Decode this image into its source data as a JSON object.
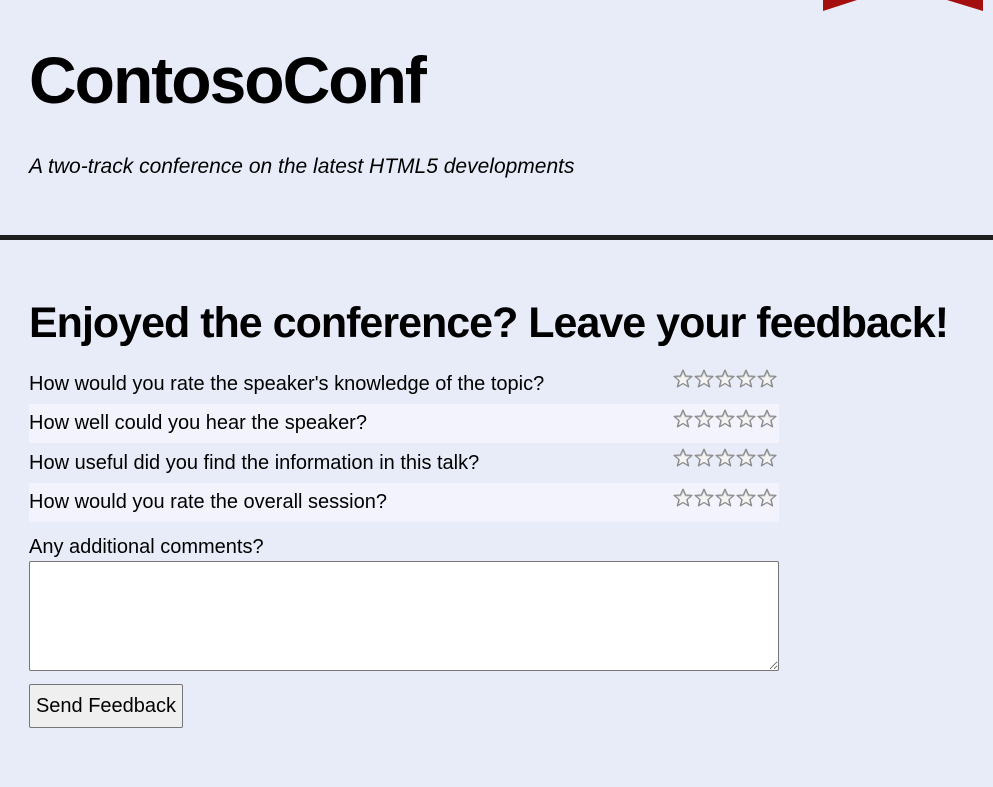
{
  "header": {
    "site_title": "ContosoConf",
    "tagline": "A two-track conference on the latest HTML5 developments"
  },
  "feedback": {
    "heading": "Enjoyed the conference? Leave your feedback!",
    "questions": [
      {
        "text": "How would you rate the speaker's knowledge of the topic?",
        "rating": 0,
        "max_rating": 5
      },
      {
        "text": "How well could you hear the speaker?",
        "rating": 0,
        "max_rating": 5
      },
      {
        "text": "How useful did you find the information in this talk?",
        "rating": 0,
        "max_rating": 5
      },
      {
        "text": "How would you rate the overall session?",
        "rating": 0,
        "max_rating": 5
      }
    ],
    "comments_label": "Any additional comments?",
    "comments_value": "",
    "submit_label": "Send Feedback"
  },
  "colors": {
    "page_background": "#e8ecf8",
    "alt_row_background": "#f3f3fe",
    "divider": "#1e1e1e",
    "ribbon": "#a50e0e",
    "star_outline": "#8a8a8a",
    "star_fill": "#d4d4d4"
  },
  "icons": {
    "rating_star": "star-outline-icon",
    "corner_ribbon": "ribbon-icon"
  }
}
